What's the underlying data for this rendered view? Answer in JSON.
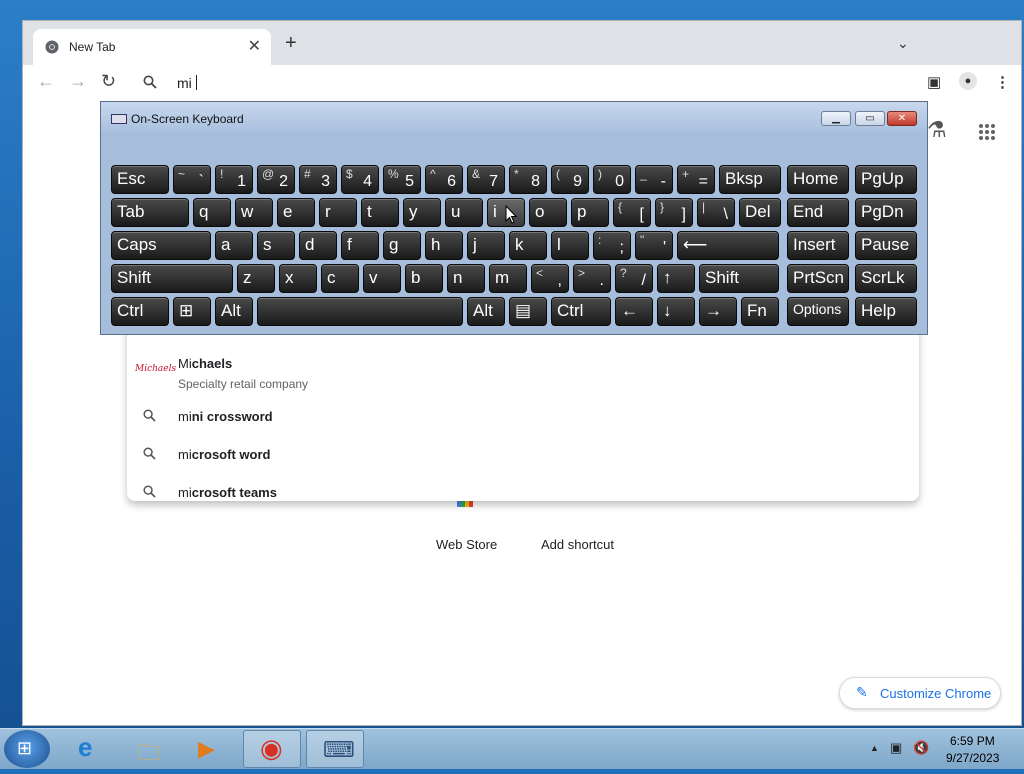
{
  "window_controls": {
    "minimize": "▁",
    "maximize": "❐",
    "close": "✕"
  },
  "browser": {
    "tab_title": "New Tab",
    "tab_close": "✕",
    "newtab": "+",
    "tabsearch": "⌄",
    "nav": {
      "back": "←",
      "forward": "→",
      "reload": "↻"
    },
    "omnibox_value": "mi",
    "toolbar_icons": {
      "sidepanel": "▣",
      "profile": "●",
      "menu": "⋮"
    },
    "ntp_icons": {
      "labs": "⚗",
      "apps": "⋮⋮⋮"
    },
    "shortcuts": [
      {
        "label": "Web Store"
      },
      {
        "label": "Add shortcut"
      }
    ],
    "customize_label": "Customize Chrome",
    "customize_icon": "✎"
  },
  "suggestions": {
    "entity": {
      "title_typed": "Mi",
      "title_rest": "chaels",
      "subtitle": "Specialty retail company",
      "logo_text": "Michaels"
    },
    "items": [
      {
        "typed": "mi",
        "rest": "ni crossword"
      },
      {
        "typed": "mi",
        "rest": "crosoft word"
      },
      {
        "typed": "mi",
        "rest": "crosoft teams"
      }
    ]
  },
  "osk": {
    "title": "On-Screen Keyboard",
    "controls": {
      "minimize": "▁",
      "restore": "▭",
      "close": "✕"
    },
    "rows": [
      [
        {
          "m": "Esc"
        },
        {
          "sh": "~",
          "lo": "`"
        },
        {
          "sh": "!",
          "lo": "1"
        },
        {
          "sh": "@",
          "lo": "2"
        },
        {
          "sh": "#",
          "lo": "3"
        },
        {
          "sh": "$",
          "lo": "4"
        },
        {
          "sh": "%",
          "lo": "5"
        },
        {
          "sh": "^",
          "lo": "6"
        },
        {
          "sh": "&",
          "lo": "7"
        },
        {
          "sh": "*",
          "lo": "8"
        },
        {
          "sh": "(",
          "lo": "9"
        },
        {
          "sh": ")",
          "lo": "0"
        },
        {
          "sh": "_",
          "lo": "-"
        },
        {
          "sh": "+",
          "lo": "="
        },
        {
          "m": "Bksp"
        },
        {
          "m": "Home"
        },
        {
          "m": "PgUp"
        }
      ],
      [
        {
          "m": "Tab"
        },
        {
          "m": "q"
        },
        {
          "m": "w"
        },
        {
          "m": "e"
        },
        {
          "m": "r"
        },
        {
          "m": "t"
        },
        {
          "m": "y"
        },
        {
          "m": "u"
        },
        {
          "m": "i"
        },
        {
          "m": "o"
        },
        {
          "m": "p"
        },
        {
          "sh": "{",
          "lo": "["
        },
        {
          "sh": "}",
          "lo": "]"
        },
        {
          "sh": "|",
          "lo": "\\"
        },
        {
          "m": "Del"
        },
        {
          "m": "End"
        },
        {
          "m": "PgDn"
        }
      ],
      [
        {
          "m": "Caps"
        },
        {
          "m": "a"
        },
        {
          "m": "s"
        },
        {
          "m": "d"
        },
        {
          "m": "f"
        },
        {
          "m": "g"
        },
        {
          "m": "h"
        },
        {
          "m": "j"
        },
        {
          "m": "k"
        },
        {
          "m": "l"
        },
        {
          "sh": ":",
          "lo": ";"
        },
        {
          "sh": "\"",
          "lo": "'"
        },
        {
          "m": "⟵"
        },
        {
          "m": "Insert"
        },
        {
          "m": "Pause"
        }
      ],
      [
        {
          "m": "Shift"
        },
        {
          "m": "z"
        },
        {
          "m": "x"
        },
        {
          "m": "c"
        },
        {
          "m": "v"
        },
        {
          "m": "b"
        },
        {
          "m": "n"
        },
        {
          "m": "m"
        },
        {
          "sh": "<",
          "lo": ","
        },
        {
          "sh": ">",
          "lo": "."
        },
        {
          "sh": "?",
          "lo": "/"
        },
        {
          "m": "↑"
        },
        {
          "m": "Shift"
        },
        {
          "m": "PrtScn"
        },
        {
          "m": "ScrLk"
        }
      ],
      [
        {
          "m": "Ctrl"
        },
        {
          "m": "⊞"
        },
        {
          "m": "Alt"
        },
        {
          "m": ""
        },
        {
          "m": "Alt"
        },
        {
          "m": "▤"
        },
        {
          "m": "Ctrl"
        },
        {
          "m": "←"
        },
        {
          "m": "↓"
        },
        {
          "m": "→"
        },
        {
          "m": "Fn"
        },
        {
          "m": "Options"
        },
        {
          "m": "Help"
        }
      ]
    ]
  },
  "taskbar": {
    "start": "⊞",
    "apps": [
      {
        "glyph": "e"
      },
      {
        "glyph": "🗀"
      },
      {
        "glyph": "▶"
      },
      {
        "glyph": "◉"
      },
      {
        "glyph": "⌨"
      }
    ],
    "tray": {
      "arrow": "▲",
      "network": "▣",
      "volume": "🔇"
    },
    "time": "6:59 PM",
    "date": "9/27/2023"
  }
}
